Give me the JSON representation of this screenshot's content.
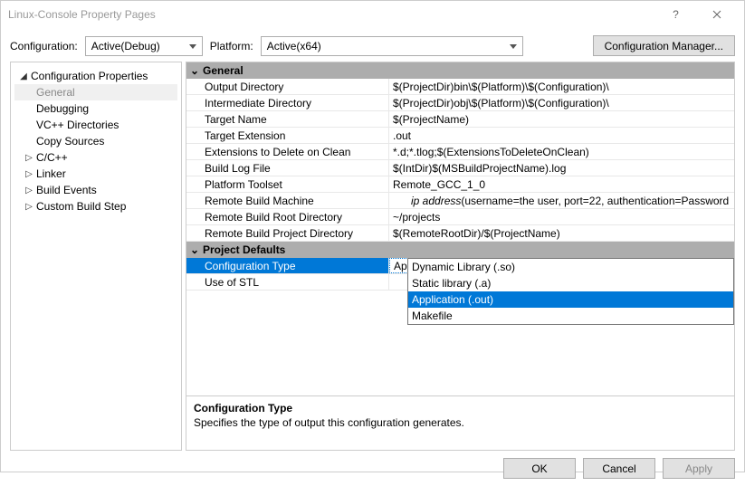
{
  "window": {
    "title": "Linux-Console Property Pages"
  },
  "config_row": {
    "config_label": "Configuration:",
    "config_value": "Active(Debug)",
    "platform_label": "Platform:",
    "platform_value": "Active(x64)",
    "manager_btn": "Configuration Manager..."
  },
  "tree": {
    "root": "Configuration Properties",
    "items": [
      {
        "label": "General",
        "selected": true
      },
      {
        "label": "Debugging"
      },
      {
        "label": "VC++ Directories"
      },
      {
        "label": "Copy Sources"
      },
      {
        "label": "C/C++",
        "expandable": true
      },
      {
        "label": "Linker",
        "expandable": true
      },
      {
        "label": "Build Events",
        "expandable": true
      },
      {
        "label": "Custom Build Step",
        "expandable": true
      }
    ]
  },
  "sections": {
    "general": {
      "header": "General",
      "rows": [
        {
          "prop": "Output Directory",
          "val": "$(ProjectDir)bin\\$(Platform)\\$(Configuration)\\"
        },
        {
          "prop": "Intermediate Directory",
          "val": "$(ProjectDir)obj\\$(Platform)\\$(Configuration)\\"
        },
        {
          "prop": "Target Name",
          "val": "$(ProjectName)"
        },
        {
          "prop": "Target Extension",
          "val": ".out"
        },
        {
          "prop": "Extensions to Delete on Clean",
          "val": "*.d;*.tlog;$(ExtensionsToDeleteOnClean)"
        },
        {
          "prop": "Build Log File",
          "val": "$(IntDir)$(MSBuildProjectName).log"
        },
        {
          "prop": "Platform Toolset",
          "val": "Remote_GCC_1_0"
        },
        {
          "prop": "Remote Build Machine",
          "val_pre": "ip address",
          "val_post": "   (username=the user, port=22, authentication=Password"
        },
        {
          "prop": "Remote Build Root Directory",
          "val": "~/projects"
        },
        {
          "prop": "Remote Build Project Directory",
          "val": "$(RemoteRootDir)/$(ProjectName)"
        }
      ]
    },
    "defaults": {
      "header": "Project Defaults",
      "rows": [
        {
          "prop": "Configuration Type",
          "val": "Application (.out)",
          "selected": true
        },
        {
          "prop": "Use of STL",
          "val": ""
        }
      ]
    }
  },
  "dropdown": {
    "options": [
      {
        "label": "Dynamic Library (.so)"
      },
      {
        "label": "Static library (.a)"
      },
      {
        "label": "Application (.out)",
        "selected": true
      },
      {
        "label": "Makefile"
      }
    ]
  },
  "description": {
    "title": "Configuration Type",
    "body": "Specifies the type of output this configuration generates."
  },
  "footer": {
    "ok": "OK",
    "cancel": "Cancel",
    "apply": "Apply"
  }
}
